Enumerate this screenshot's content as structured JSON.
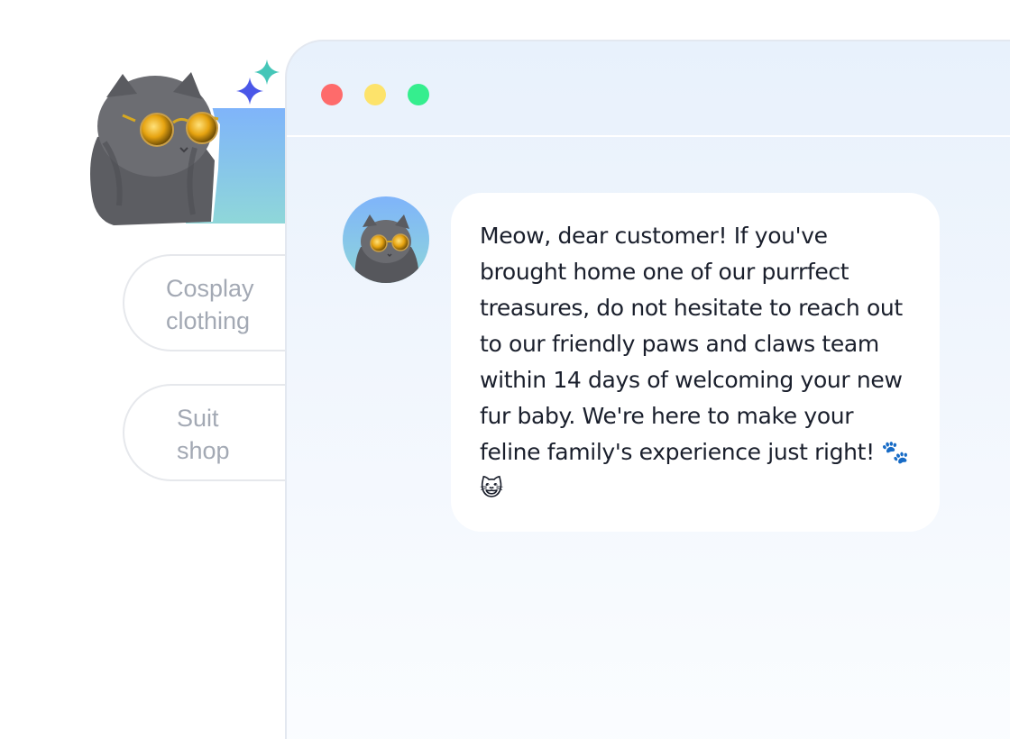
{
  "categories": [
    {
      "label": "Cosplay clothing"
    },
    {
      "label": "Suit shop"
    }
  ],
  "window": {
    "controls": [
      {
        "name": "close",
        "color": "#fe6b6b"
      },
      {
        "name": "minimize",
        "color": "#fde36b"
      },
      {
        "name": "maximize",
        "color": "#35ee8e"
      }
    ]
  },
  "chat": {
    "messages": [
      {
        "sender": "bot",
        "avatar": "cat-with-sunglasses",
        "text": "Meow, dear customer! If you've brought home one of our purrfect treasures, do not hesitate to reach out to our friendly paws and claws team within 14 days of welcoming your new fur baby. We're here to make your feline family's experience just right! 🐾😺"
      }
    ]
  },
  "colors": {
    "accent_gradient_top": "#7fb4fa",
    "accent_gradient_bottom": "#8fd7d9",
    "sparkle_blue": "#4a57e8",
    "sparkle_teal": "#45c6b8"
  }
}
